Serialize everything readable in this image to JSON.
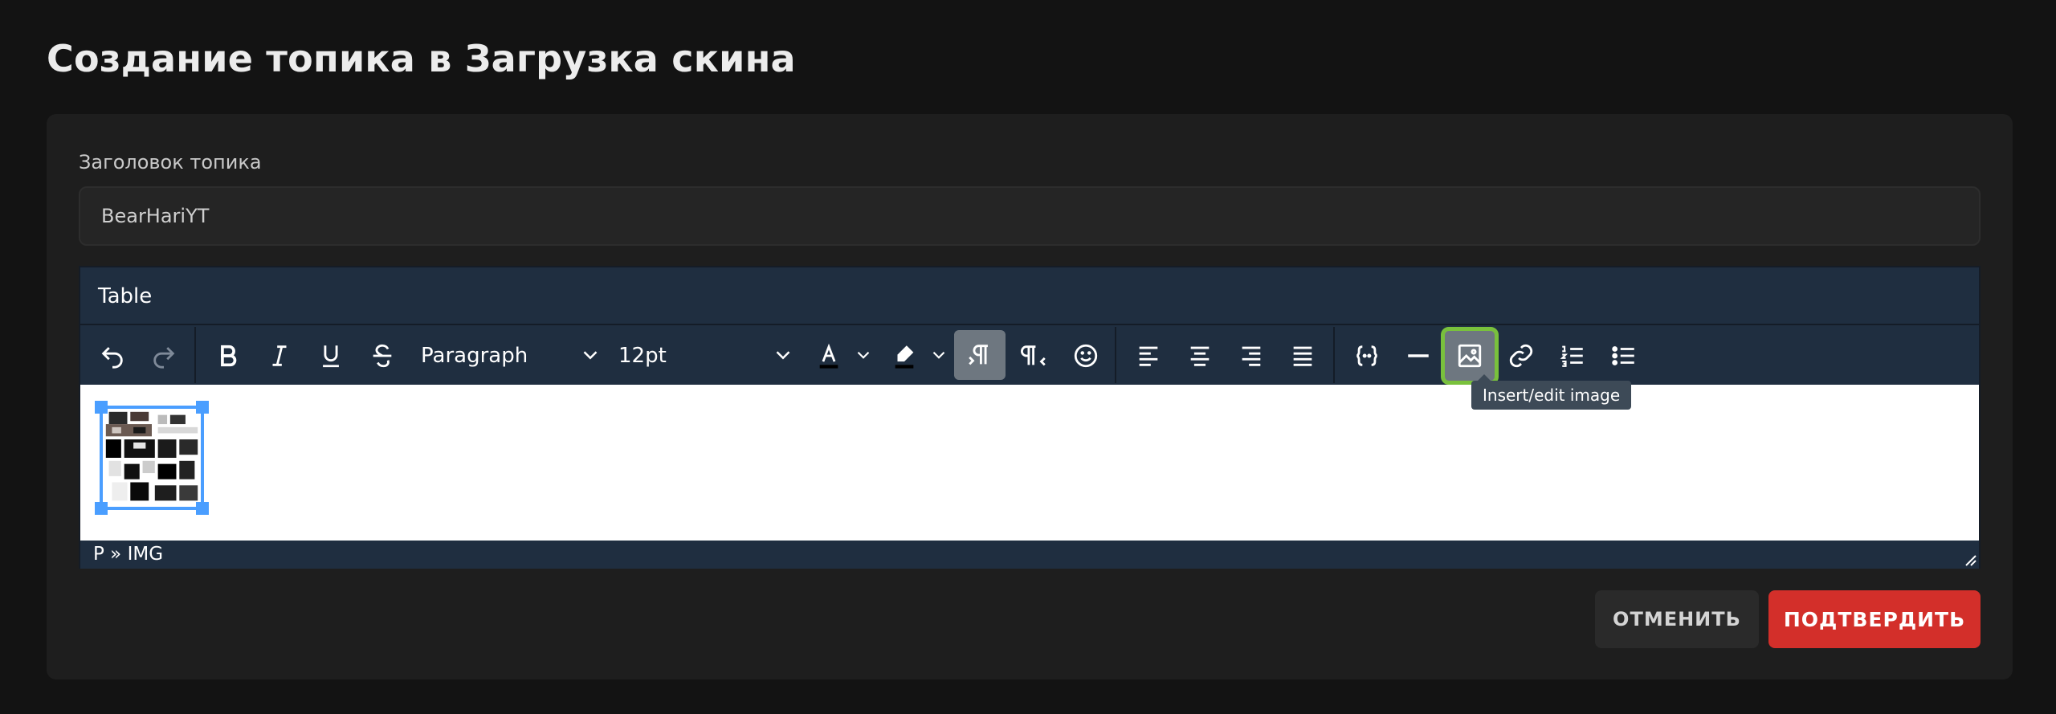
{
  "page": {
    "title": "Создание топика в Загрузка скина"
  },
  "form": {
    "title_label": "Заголовок топика",
    "title_value": "BearHariYT"
  },
  "editor": {
    "menubar": [
      "Table"
    ],
    "toolbar": {
      "block_format": "Paragraph",
      "font_size": "12pt",
      "icons": [
        "undo-icon",
        "redo-icon",
        "bold-icon",
        "italic-icon",
        "underline-icon",
        "strikethrough-icon",
        "text-color-icon",
        "highlight-color-icon",
        "ltr-icon",
        "rtl-icon",
        "emoji-icon",
        "align-left-icon",
        "align-center-icon",
        "align-right-icon",
        "align-justify-icon",
        "code-sample-icon",
        "horizontal-rule-icon",
        "image-icon",
        "link-icon",
        "numbered-list-icon",
        "bullet-list-icon"
      ],
      "active": [
        "ltr-icon"
      ],
      "highlighted": "image-icon"
    },
    "tooltip": "Insert/edit image",
    "statusbar_path": "P » IMG",
    "colors": {
      "chrome": "#1f2e40",
      "selection": "#4a9eff",
      "focus_ring": "#79c13c"
    }
  },
  "actions": {
    "cancel": "ОТМЕНИТЬ",
    "confirm": "ПОДТВЕРДИТЬ"
  },
  "colors": {
    "background": "#131313",
    "card": "#1e1e1e",
    "confirm": "#d32f2a"
  }
}
